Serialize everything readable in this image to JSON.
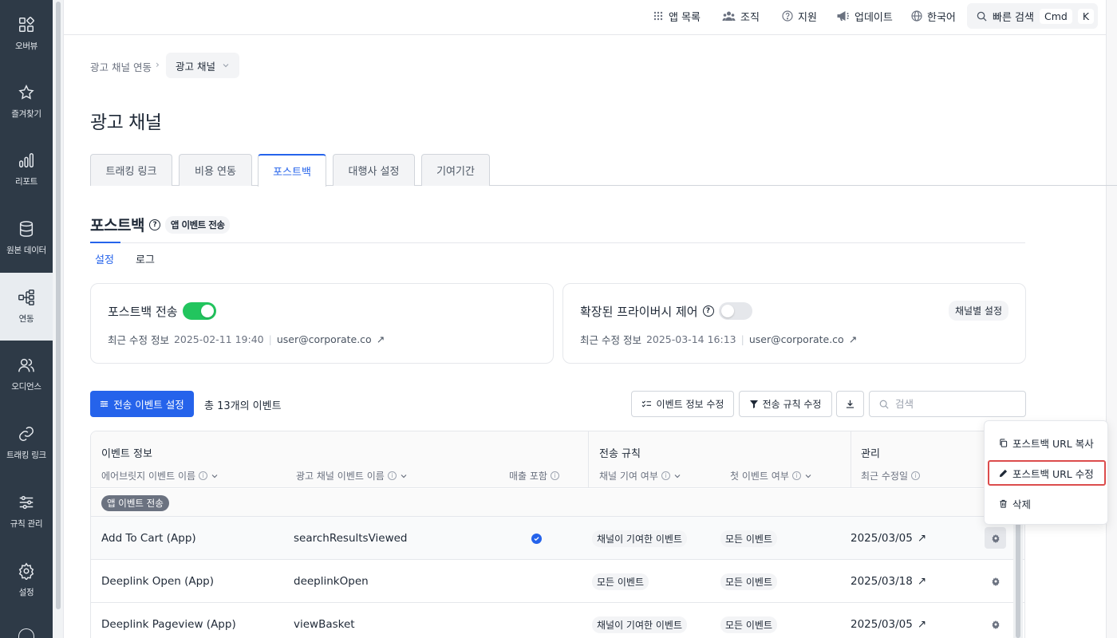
{
  "sidebar": {
    "items": [
      {
        "label": "오버뷰",
        "icon": "overview-icon"
      },
      {
        "label": "즐겨찾기",
        "icon": "star-icon"
      },
      {
        "label": "리포트",
        "icon": "bar-chart-icon"
      },
      {
        "label": "원본 데이터",
        "icon": "database-icon"
      },
      {
        "label": "연동",
        "icon": "integration-icon"
      },
      {
        "label": "오디언스",
        "icon": "audience-icon"
      },
      {
        "label": "트래킹 링크",
        "icon": "link-icon"
      },
      {
        "label": "규칙 관리",
        "icon": "sliders-icon"
      },
      {
        "label": "설정",
        "icon": "gear-icon"
      }
    ]
  },
  "topbar": {
    "app_list": "앱 목록",
    "org": "조직",
    "support": "지원",
    "updates": "업데이트",
    "language": "한국어",
    "quick_search": "빠른 검색",
    "shortcut_mod": "Cmd",
    "shortcut_key": "K"
  },
  "breadcrumb": {
    "parent": "광고 채널 연동",
    "current": "광고 채널"
  },
  "page_title": "광고 채널",
  "tabs": [
    {
      "label": "트래킹 링크",
      "active": false
    },
    {
      "label": "비용 연동",
      "active": false
    },
    {
      "label": "포스트백",
      "active": true
    },
    {
      "label": "대행사 설정",
      "active": false
    },
    {
      "label": "기여기간",
      "active": false
    }
  ],
  "section": {
    "title": "포스트백",
    "badge": "앱 이벤트 전송",
    "subtabs": [
      "설정",
      "로그"
    ]
  },
  "cards": {
    "postback": {
      "title": "포스트백 전송",
      "enabled": true,
      "meta_label": "최근 수정 정보",
      "meta_time": "2025-02-11 19:40",
      "meta_user": "user@corporate.co"
    },
    "privacy": {
      "title": "확장된 프라이버시 제어",
      "enabled": false,
      "channel_btn": "채널별 설정",
      "meta_label": "최근 수정 정보",
      "meta_time": "2025-03-14 16:13",
      "meta_user": "user@corporate.co"
    }
  },
  "toolbar": {
    "primary": "전송 이벤트 설정",
    "total": "총 13개의 이벤트",
    "edit_event_info": "이벤트 정보 수정",
    "edit_rules": "전송 규칙 수정",
    "search_placeholder": "검색"
  },
  "table": {
    "groups": {
      "event_info": "이벤트 정보",
      "send_rules": "전송 규칙",
      "manage": "관리"
    },
    "columns": {
      "airbridge_event": "에어브릿지 이벤트 이름",
      "channel_event": "광고 채널 이벤트 이름",
      "revenue": "매출 포함",
      "channel_contrib": "채널 기여 여부",
      "first_event": "첫 이벤트 여부",
      "last_modified": "최근 수정일"
    },
    "group_label": "앱 이벤트 전송",
    "rows": [
      {
        "event": "Add To Cart (App)",
        "channel_event": "searchResultsViewed",
        "revenue": true,
        "contrib": "채널이 기여한 이벤트",
        "first": "모든 이벤트",
        "date": "2025/03/05"
      },
      {
        "event": "Deeplink Open (App)",
        "channel_event": "deeplinkOpen",
        "revenue": false,
        "contrib": "모든 이벤트",
        "first": "모든 이벤트",
        "date": "2025/03/18"
      },
      {
        "event": "Deeplink Pageview (App)",
        "channel_event": "viewBasket",
        "revenue": false,
        "contrib": "채널이 기여한 이벤트",
        "first": "모든 이벤트",
        "date": "2025/03/05"
      }
    ]
  },
  "menu": {
    "copy": "포스트백 URL 복사",
    "edit": "포스트백 URL 수정",
    "delete": "삭제"
  },
  "colors": {
    "sidebar_bg": "#2e3a47",
    "accent": "#2563eb",
    "toggle_on": "#22c55e",
    "highlight": "#dc4c4c"
  }
}
